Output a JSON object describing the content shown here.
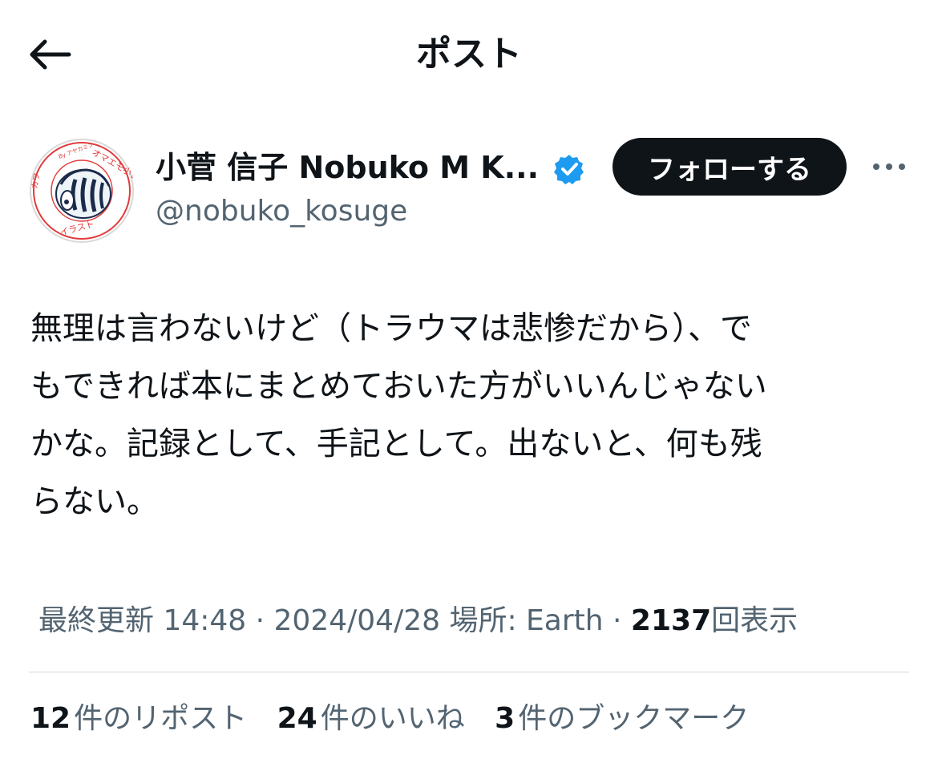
{
  "header": {
    "back_icon": "arrow-left-icon",
    "title": "ポスト"
  },
  "author": {
    "display_name": "小菅 信子 Nobuko M K...",
    "handle": "@nobuko_kosuge",
    "verified_icon": "verified-badge-icon",
    "verified_color": "#1d9bf0",
    "follow_label": "フォローする",
    "more_icon": "more-horizontal-icon",
    "avatar_text": {
      "outer_top": "オマエモ小菅",
      "outer_bottom": "イラスト",
      "small": "By アヤカミン",
      "left": "カワ"
    }
  },
  "post": {
    "text": "無理は言わないけど（トラウマは悲惨だから）、で\nもできれば本にまとめておいた方がいいんじゃない\nかな。記録として、手記として。出ないと、何も残\nらない。"
  },
  "meta": {
    "updated_label": "最終更新 14:48 · 2024/04/28",
    "location_label": "場所: Earth ·",
    "views_count": "2137",
    "views_label": "回表示"
  },
  "stats": {
    "reposts_count": "12",
    "reposts_label": "件のリポスト",
    "likes_count": "24",
    "likes_label": "件のいいね",
    "bookmarks_count": "3",
    "bookmarks_label": "件のブックマーク"
  },
  "colors": {
    "text_primary": "#0f1419",
    "text_secondary": "#536471",
    "divider": "#cfd9de",
    "button_bg": "#0f1419",
    "accent": "#1d9bf0"
  }
}
